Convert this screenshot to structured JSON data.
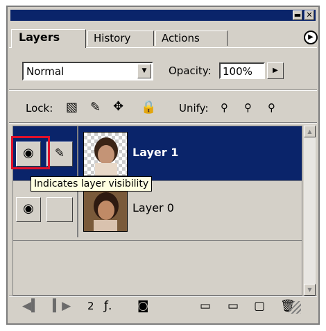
{
  "tabs": [
    {
      "label": "Layers",
      "active": true
    },
    {
      "label": "History",
      "active": false
    },
    {
      "label": "Actions",
      "active": false
    }
  ],
  "window_buttons": {
    "minimize": "▬",
    "close": "✕"
  },
  "panel_menu_icon": "flyout-arrow",
  "blend_mode": {
    "value": "Normal"
  },
  "opacity": {
    "label": "Opacity:",
    "value": "100%"
  },
  "lock": {
    "label": "Lock:"
  },
  "unify": {
    "label": "Unify:"
  },
  "layers": [
    {
      "name": "Layer 1",
      "selected": true,
      "visible": true,
      "brush_linked": true
    },
    {
      "name": "Layer 0",
      "selected": false,
      "visible": true,
      "brush_linked": false
    }
  ],
  "tooltip": "Indicates layer visibility",
  "animation_frame": "2",
  "colors": {
    "selection": "#0a246a",
    "highlight": "#e0102a",
    "panel": "#d4d0c8"
  }
}
